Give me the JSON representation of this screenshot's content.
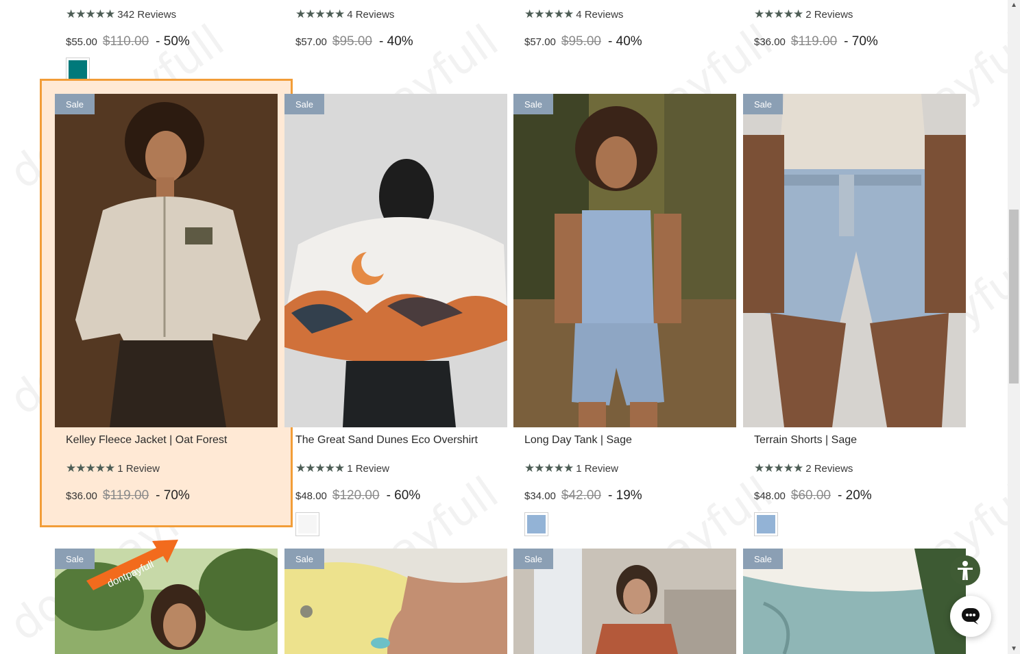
{
  "sale_label": "Sale",
  "colors": {
    "highlight_border": "#f29d38",
    "highlight_bg": "#ffe9d5",
    "badge": "#8b9fb4",
    "star": "#4d5d55",
    "accessibility": "#3f5b34"
  },
  "star_glyphs": "★★★★★",
  "top_row": [
    {
      "reviews": "342 Reviews",
      "price": "$55.00",
      "compare": "$110.00",
      "discount": "- 50%",
      "swatch": "#00797a"
    },
    {
      "reviews": "4 Reviews",
      "price": "$57.00",
      "compare": "$95.00",
      "discount": "- 40%"
    },
    {
      "reviews": "4 Reviews",
      "price": "$57.00",
      "compare": "$95.00",
      "discount": "- 40%"
    },
    {
      "reviews": "2 Reviews",
      "price": "$36.00",
      "compare": "$119.00",
      "discount": "- 70%"
    }
  ],
  "products": [
    {
      "title": "Kelley Fleece Jacket | Oat Forest",
      "reviews": "1 Review",
      "price": "$36.00",
      "compare": "$119.00",
      "discount": "- 70%"
    },
    {
      "title": "The Great Sand Dunes Eco Overshirt",
      "reviews": "1 Review",
      "price": "$48.00",
      "compare": "$120.00",
      "discount": "- 60%",
      "swatch": "#f6f6f6"
    },
    {
      "title": "Long Day Tank | Sage",
      "reviews": "1 Review",
      "price": "$34.00",
      "compare": "$42.00",
      "discount": "- 19%",
      "swatch": "#93b3d6"
    },
    {
      "title": "Terrain Shorts | Sage",
      "reviews": "2 Reviews",
      "price": "$48.00",
      "compare": "$60.00",
      "discount": "- 20%",
      "swatch": "#93b3d6"
    }
  ],
  "watermark_text": "dontpayfull",
  "banner_text": "dontpayfull"
}
